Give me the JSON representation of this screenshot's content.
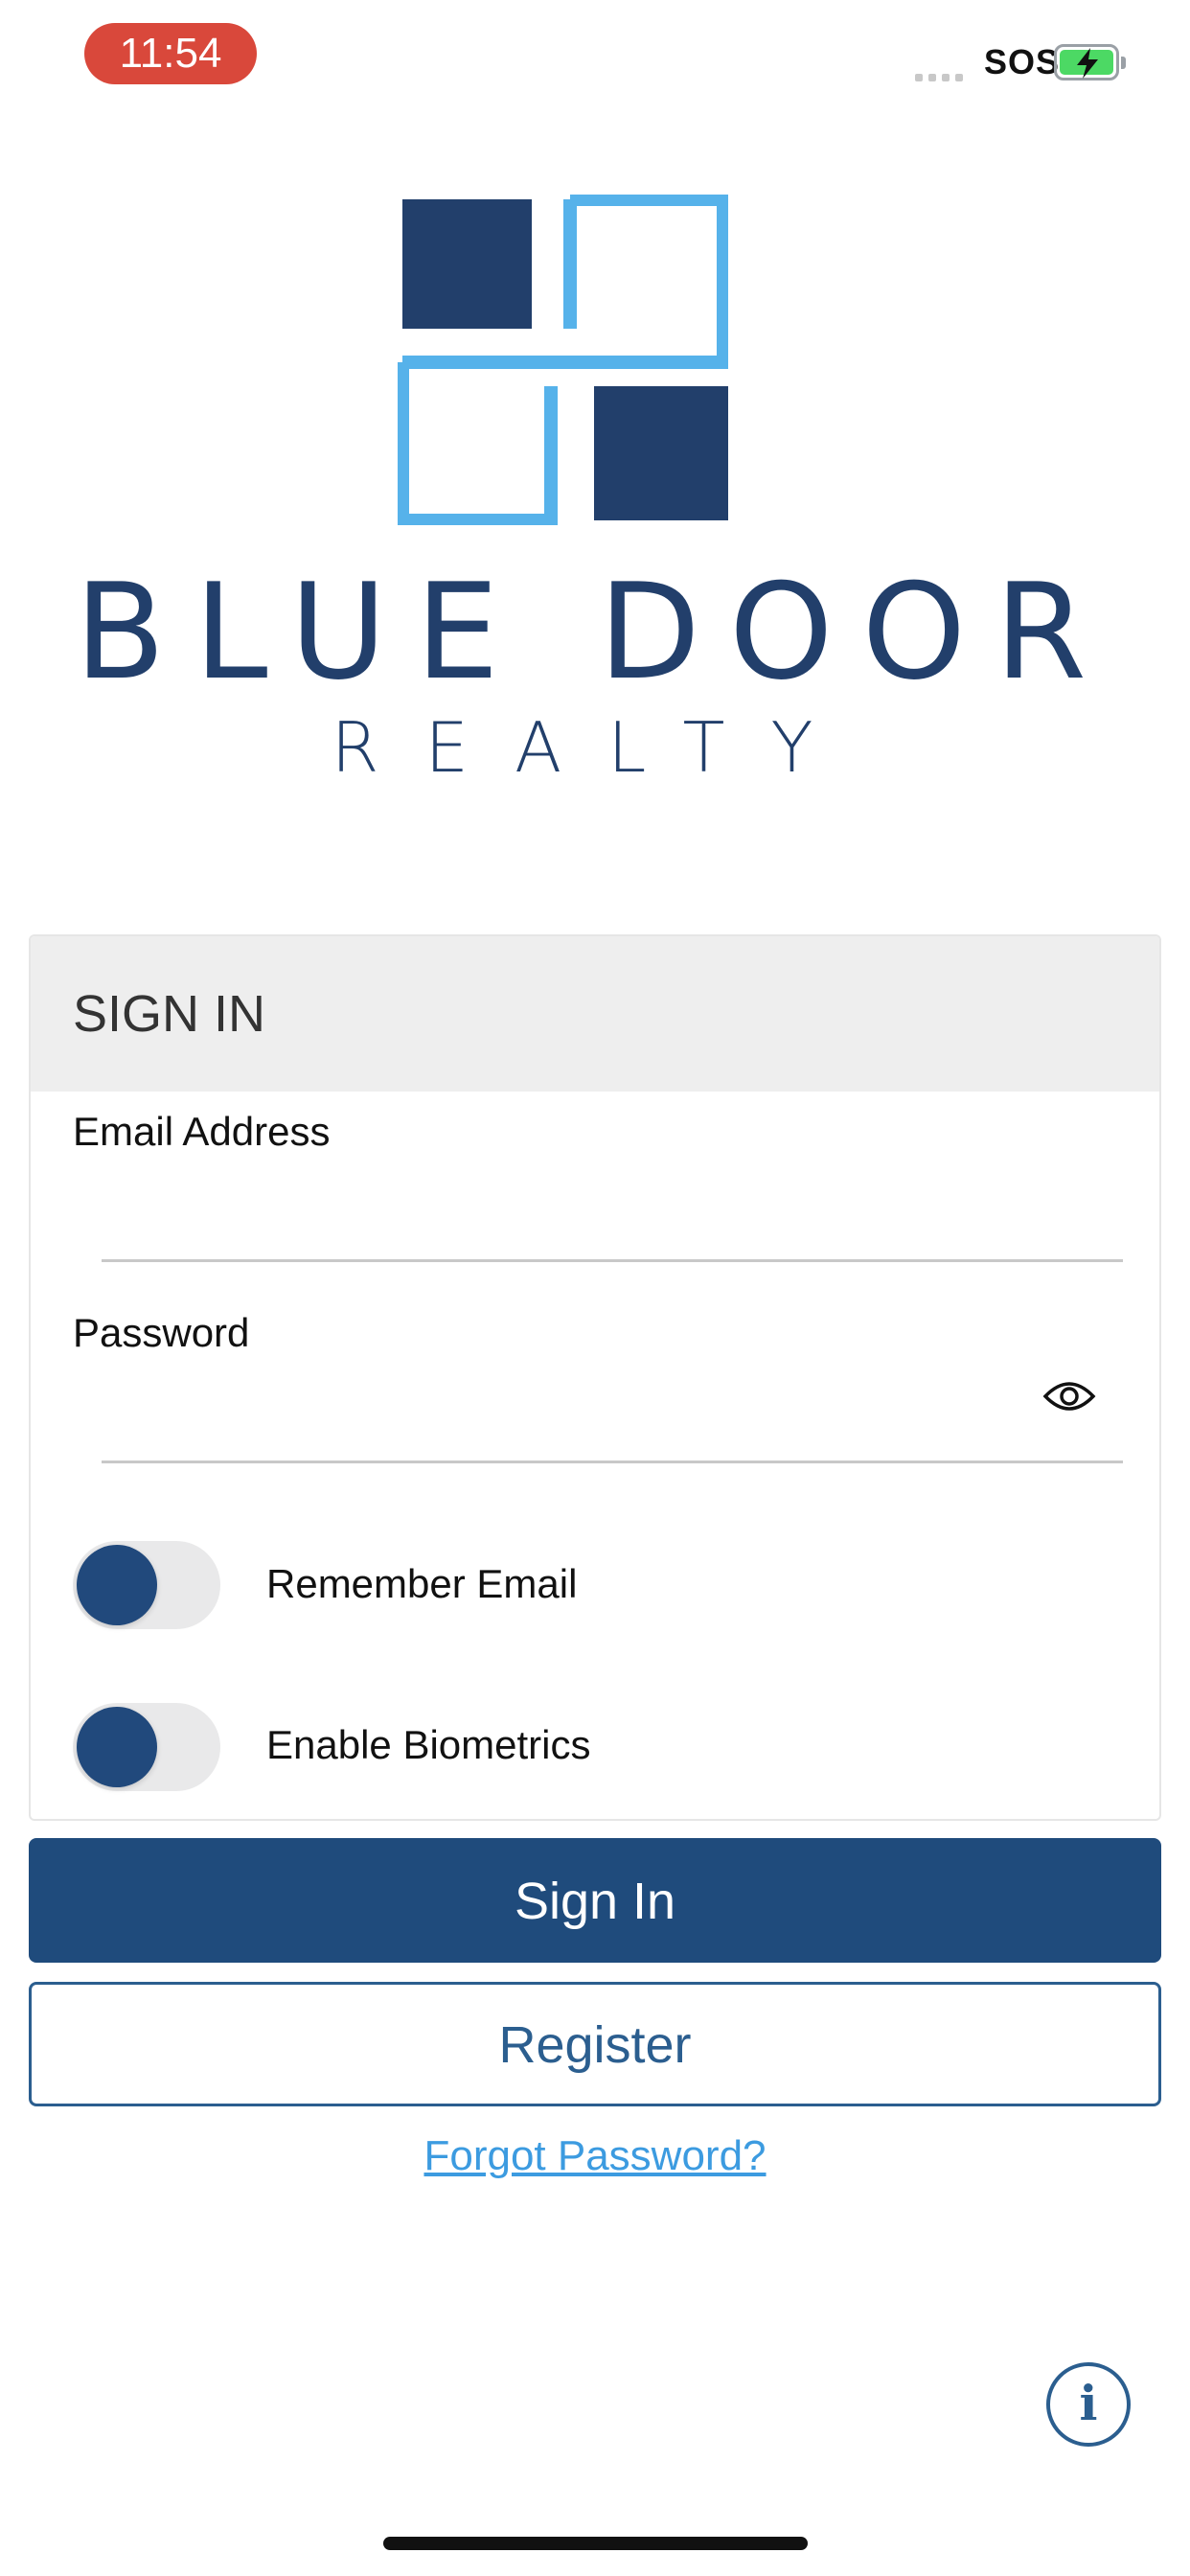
{
  "status_bar": {
    "time": "11:54",
    "carrier": "SOS",
    "battery_state": "charging",
    "battery_color": "#4cd964"
  },
  "brand": {
    "name": "BLUE DOOR",
    "tagline": "REALTY",
    "dark_color": "#223f6b",
    "light_color": "#56b2ea"
  },
  "sign_in_card": {
    "title": "SIGN IN",
    "email_label": "Email Address",
    "email_value": "",
    "password_label": "Password",
    "password_value": "",
    "password_toggle_icon": "eye-icon",
    "toggles": [
      {
        "label": "Remember Email",
        "on": false
      },
      {
        "label": "Enable Biometrics",
        "on": false
      }
    ]
  },
  "actions": {
    "sign_in_label": "Sign In",
    "register_label": "Register",
    "forgot_password_label": "Forgot Password?",
    "info_icon": "info-icon",
    "primary_color": "#1f4b7c",
    "link_color": "#3c9be0"
  }
}
